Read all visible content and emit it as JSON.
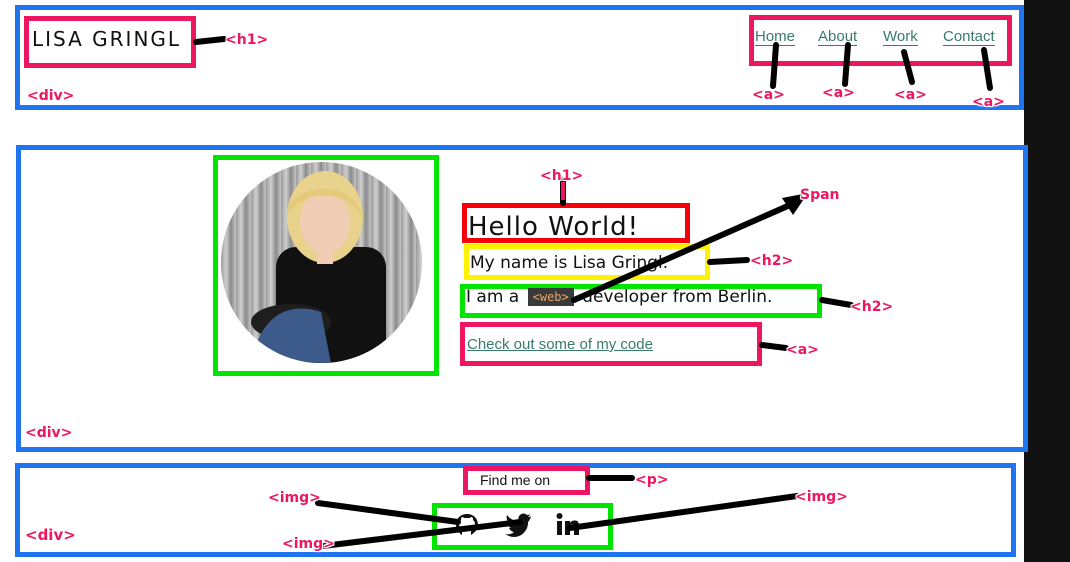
{
  "header": {
    "logo": "LISA GRINGL",
    "nav": [
      "Home",
      "About",
      "Work",
      "Contact"
    ]
  },
  "hero": {
    "heading": "Hello World!",
    "intro": "My name is Lisa Gringl.",
    "role_prefix": "I am a",
    "role_code": "<web>",
    "role_suffix": "developer from Berlin.",
    "code_link": "Check out some of my code"
  },
  "footer": {
    "find_me": "Find me on"
  },
  "annotations": {
    "h1_logo": "<h1>",
    "header_div": "<div>",
    "a_home": "<a>",
    "a_about": "<a>",
    "a_work": "<a>",
    "a_contact": "<a>",
    "h1_hero": "<h1>",
    "span": "Span",
    "h2_intro": "<h2>",
    "h2_role": "<h2>",
    "a_code": "<a>",
    "hero_div": "<div>",
    "p_find": "<p>",
    "img_left": "<img>",
    "img_right": "<img>",
    "img_bottom": "<img>",
    "footer_div": "<div>"
  },
  "icons": [
    "github-icon",
    "twitter-icon",
    "linkedin-icon"
  ],
  "colors": {
    "div_outline": "#1f74f2",
    "tag_pink": "#ee1660",
    "h1_red": "#f5000a",
    "h2_yellow": "#fff200",
    "green": "#00e400",
    "link_green": "#3a7a6c"
  }
}
